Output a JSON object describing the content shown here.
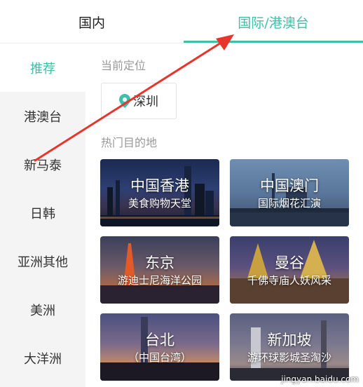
{
  "tabs": [
    {
      "label": "国内",
      "active": false
    },
    {
      "label": "国际/港澳台",
      "active": true
    }
  ],
  "colors": {
    "accent": "#3dbfa8",
    "annotation_arrow": "#e8352b"
  },
  "sidebar": {
    "items": [
      {
        "label": "推荐",
        "active": true
      },
      {
        "label": "港澳台",
        "active": false
      },
      {
        "label": "新马泰",
        "active": false
      },
      {
        "label": "日韩",
        "active": false
      },
      {
        "label": "亚洲其他",
        "active": false
      },
      {
        "label": "美洲",
        "active": false
      },
      {
        "label": "大洋洲",
        "active": false
      }
    ]
  },
  "main": {
    "current_location_label": "当前定位",
    "current_location_city": "深圳",
    "location_icon": "location-pin-icon",
    "hot_destinations_label": "热门目的地",
    "destinations": [
      {
        "title": "中国香港",
        "subtitle": "美食购物天堂"
      },
      {
        "title": "中国澳门",
        "subtitle": "国际烟花汇演"
      },
      {
        "title": "东京",
        "subtitle": "游迪士尼海洋公园"
      },
      {
        "title": "曼谷",
        "subtitle": "千佛寺庙人妖风采"
      },
      {
        "title": "台北",
        "subtitle": "（中国台湾）"
      },
      {
        "title": "新加坡",
        "subtitle": "游环球影城圣淘沙"
      }
    ]
  },
  "watermark": "jingyan.baidu.com"
}
